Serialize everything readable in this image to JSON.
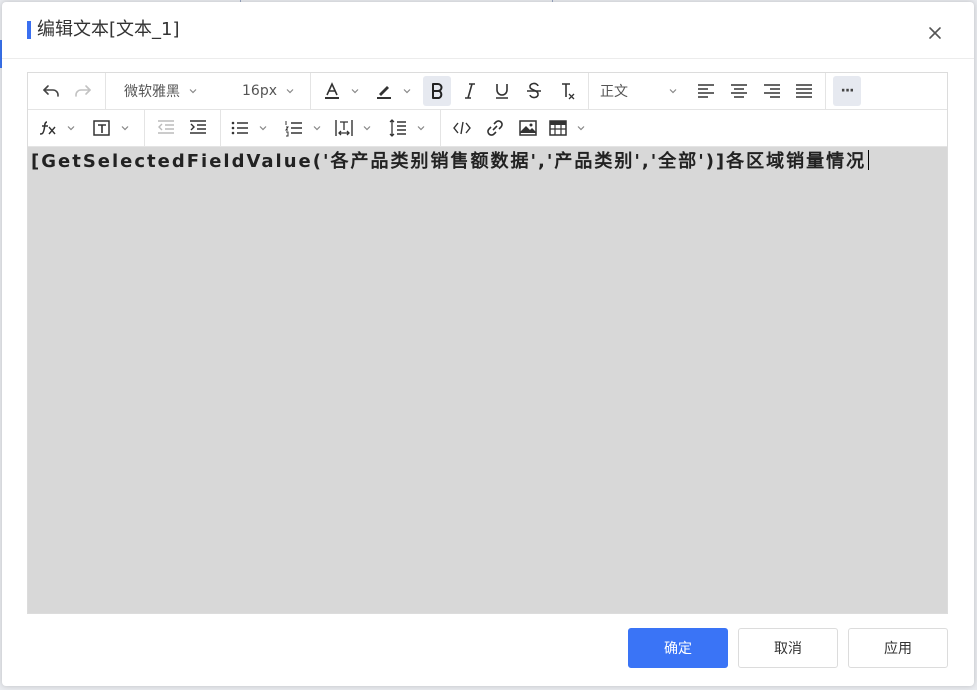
{
  "dialog": {
    "title": "编辑文本[文本_1]"
  },
  "toolbar": {
    "font_family": "微软雅黑",
    "font_size": "16px",
    "paragraph_style": "正文",
    "more_label": "···"
  },
  "editor": {
    "content": "[GetSelectedFieldValue('各产品类别销售额数据','产品类别','全部')]各区域销量情况"
  },
  "buttons": {
    "confirm": "确定",
    "cancel": "取消",
    "apply": "应用"
  },
  "colors": {
    "accent": "#3a74f6",
    "editor_bg": "#d8d8d8",
    "active_tool_bg": "#e6e9f0"
  }
}
